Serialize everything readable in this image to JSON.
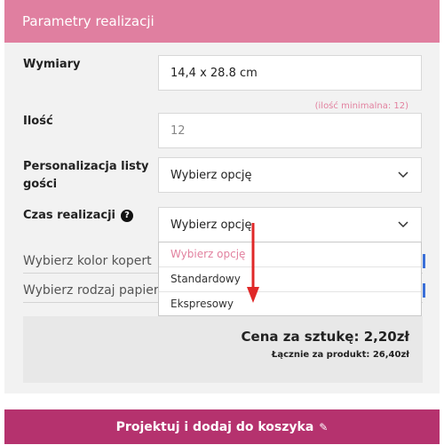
{
  "header": {
    "title": "Parametry realizacji"
  },
  "fields": {
    "dimensions": {
      "label": "Wymiary",
      "value": "14,4 x 28.8 cm"
    },
    "quantity": {
      "label": "Ilość",
      "value": "12",
      "hint": "(ilość minimalna: 12)"
    },
    "guest_list": {
      "label_line1": "Personalizacja listy",
      "label_line2": "gości",
      "value": "Wybierz opcję"
    },
    "lead_time": {
      "label": "Czas realizacji",
      "value": "Wybierz opcję",
      "help_icon": "question-icon"
    }
  },
  "dropdown": {
    "options": [
      "Wybierz opcję",
      "Standardowy",
      "Ekspresowy"
    ]
  },
  "hidden_rows": {
    "envelope_color": "Wybierz kolor kopert",
    "paper_type": "Wybierz rodzaj papieru"
  },
  "price": {
    "unit": "Cena za sztukę: 2,20zł",
    "total": "Łącznie za produkt: 26,40zł"
  },
  "cta": {
    "label": "Projektuj i dodaj do koszyka",
    "icon": "pencil-icon"
  },
  "colors": {
    "header": "#e07fa0",
    "cta": "#b5326e",
    "hint": "#e2819f",
    "arrow": "#e02828"
  }
}
